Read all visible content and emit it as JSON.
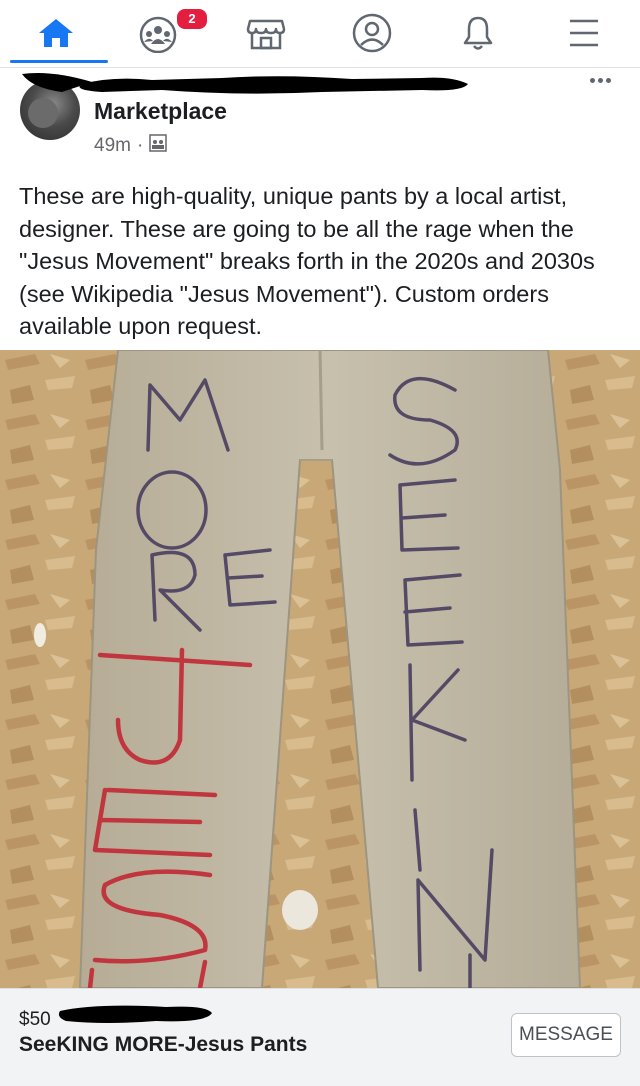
{
  "nav": {
    "items": [
      {
        "name": "home",
        "icon": "home-icon",
        "active": true
      },
      {
        "name": "groups",
        "icon": "groups-icon",
        "badge": "2"
      },
      {
        "name": "marketplace",
        "icon": "marketplace-icon"
      },
      {
        "name": "profile",
        "icon": "profile-icon"
      },
      {
        "name": "notifications",
        "icon": "bell-icon"
      },
      {
        "name": "menu",
        "icon": "menu-icon"
      }
    ],
    "accent_color": "#1877f2",
    "badge_color": "#e41e3f"
  },
  "post": {
    "title": "Marketplace",
    "time": "49m",
    "separator": "·",
    "audience_icon": "group-audience-icon",
    "text": "These are high-quality, unique pants by a local artist, designer. These are going to be all the rage when the \"Jesus Movement\" breaks forth in the 2020s and 2030s (see Wikipedia \"Jesus Movement\").  Custom orders available upon request."
  },
  "listing": {
    "price": "$50",
    "title": "SeeKING MORE-Jesus Pants",
    "message_label": "MESSAGE"
  }
}
